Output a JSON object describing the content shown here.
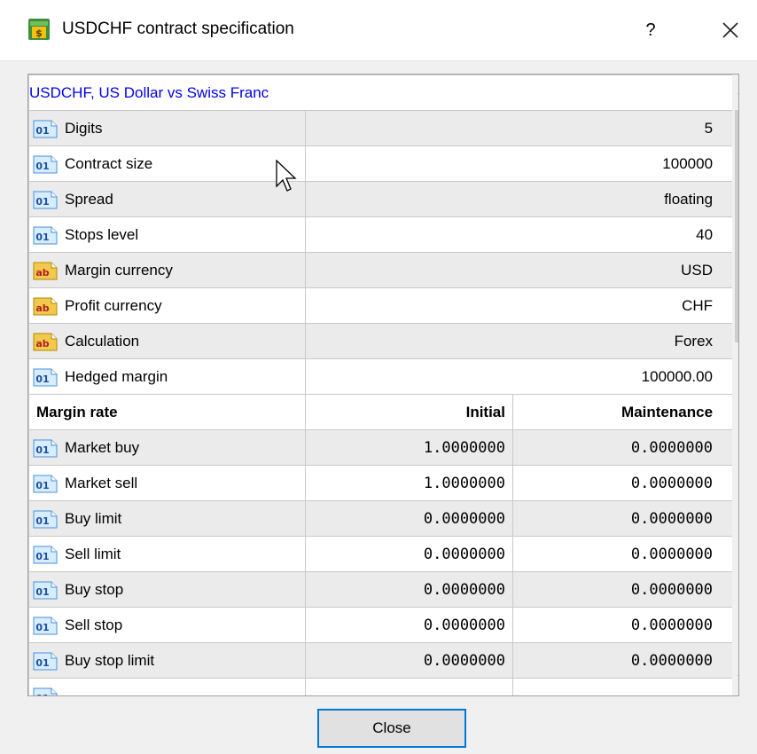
{
  "window": {
    "title": "USDCHF contract specification",
    "help_label": "?",
    "close_button": "Close"
  },
  "symbol_line": "USDCHF, US Dollar vs Swiss Franc",
  "specs": [
    {
      "icon": "numeric-icon",
      "name": "Digits",
      "value": "5"
    },
    {
      "icon": "numeric-icon",
      "name": "Contract size",
      "value": "100000"
    },
    {
      "icon": "numeric-icon",
      "name": "Spread",
      "value": "floating"
    },
    {
      "icon": "numeric-icon",
      "name": "Stops level",
      "value": "40"
    },
    {
      "icon": "text-icon",
      "name": "Margin currency",
      "value": "USD"
    },
    {
      "icon": "text-icon",
      "name": "Profit currency",
      "value": "CHF"
    },
    {
      "icon": "text-icon",
      "name": "Calculation",
      "value": "Forex"
    },
    {
      "icon": "numeric-icon",
      "name": "Hedged margin",
      "value": "100000.00"
    }
  ],
  "margin_header": {
    "name": "Margin rate",
    "initial": "Initial",
    "maintenance": "Maintenance"
  },
  "margin_rows": [
    {
      "name": "Market buy",
      "initial": "1.0000000",
      "maintenance": "0.0000000"
    },
    {
      "name": "Market sell",
      "initial": "1.0000000",
      "maintenance": "0.0000000"
    },
    {
      "name": "Buy limit",
      "initial": "0.0000000",
      "maintenance": "0.0000000"
    },
    {
      "name": "Sell limit",
      "initial": "0.0000000",
      "maintenance": "0.0000000"
    },
    {
      "name": "Buy stop",
      "initial": "0.0000000",
      "maintenance": "0.0000000"
    },
    {
      "name": "Sell stop",
      "initial": "0.0000000",
      "maintenance": "0.0000000"
    },
    {
      "name": "Buy stop limit",
      "initial": "0.0000000",
      "maintenance": "0.0000000"
    }
  ],
  "colors": {
    "symbol_link": "#0000ee",
    "focus_border": "#0078d7",
    "row_alt": "#ebebeb"
  }
}
